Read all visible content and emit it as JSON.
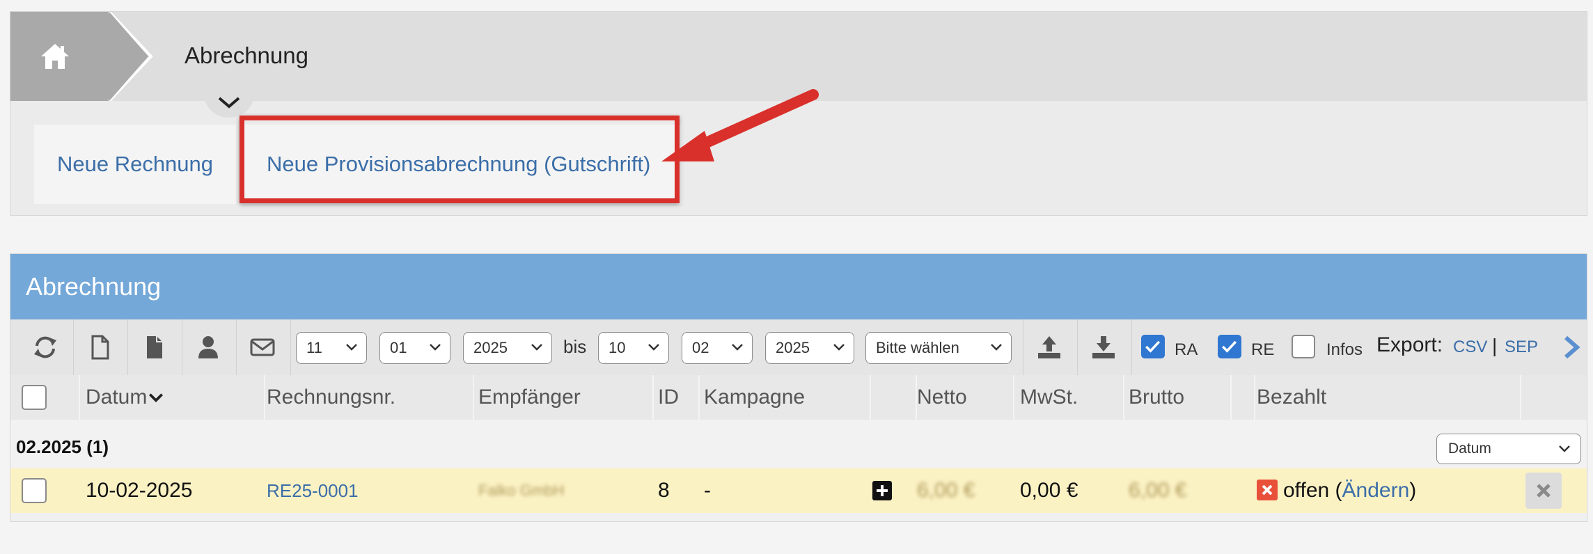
{
  "breadcrumb": {
    "title": "Abrechnung"
  },
  "actions": {
    "new_invoice": "Neue Rechnung",
    "new_commission": "Neue Provisionsabrechnung (Gutschrift)"
  },
  "panel": {
    "title": "Abrechnung"
  },
  "filters": {
    "from_day": "11",
    "from_month": "01",
    "from_year": "2025",
    "bis": "bis",
    "to_day": "10",
    "to_month": "02",
    "to_year": "2025",
    "type_select": "Bitte wählen"
  },
  "checkboxes": {
    "ra": {
      "label": "RA",
      "checked": true
    },
    "re": {
      "label": "RE",
      "checked": true
    },
    "infos": {
      "label": "Infos",
      "checked": false
    }
  },
  "export": {
    "label": "Export:",
    "csv": "CSV",
    "separator": "|",
    "sepa": "SEP"
  },
  "table": {
    "headers": {
      "datum": "Datum",
      "rechnungsnr": "Rechnungsnr.",
      "empfaenger": "Empfänger",
      "id": "ID",
      "kampagne": "Kampagne",
      "netto": "Netto",
      "mwst": "MwSt.",
      "brutto": "Brutto",
      "bezahlt": "Bezahlt"
    },
    "group": {
      "title": "02.2025 (1)",
      "sort_select": "Datum"
    },
    "rows": [
      {
        "datum": "10-02-2025",
        "rechnungsnr": "RE25-0001",
        "empfaenger": "Falko GmbH",
        "id": "8",
        "kampagne": "-",
        "netto": "6,00 €",
        "mwst": "0,00 €",
        "brutto": "6,00 €",
        "status_text": "offen (",
        "status_link": "Ändern",
        "status_close": ")"
      }
    ]
  },
  "colors": {
    "header_blue": "#74a8d8",
    "link_blue": "#3b6ea8",
    "highlight_red": "#d9302b",
    "row_yellow": "#fbf2c4"
  }
}
